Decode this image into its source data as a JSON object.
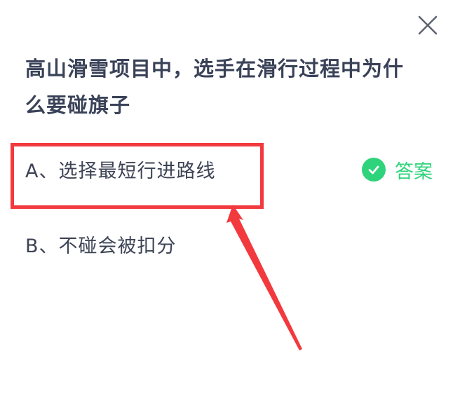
{
  "question": {
    "line1": "高山滑雪项目中，选手在滑行过程中为什",
    "line2": "么要碰旗子"
  },
  "options": [
    {
      "label": "A、选择最短行进路线"
    },
    {
      "label": "B、不碰会被扣分"
    }
  ],
  "answer_tag": "答案",
  "icons": {
    "close": "close-icon",
    "check": "check-circle-icon"
  },
  "colors": {
    "answer_green": "#2fd37b",
    "highlight_red": "#f23a3e",
    "question_text": "#3a4258"
  }
}
